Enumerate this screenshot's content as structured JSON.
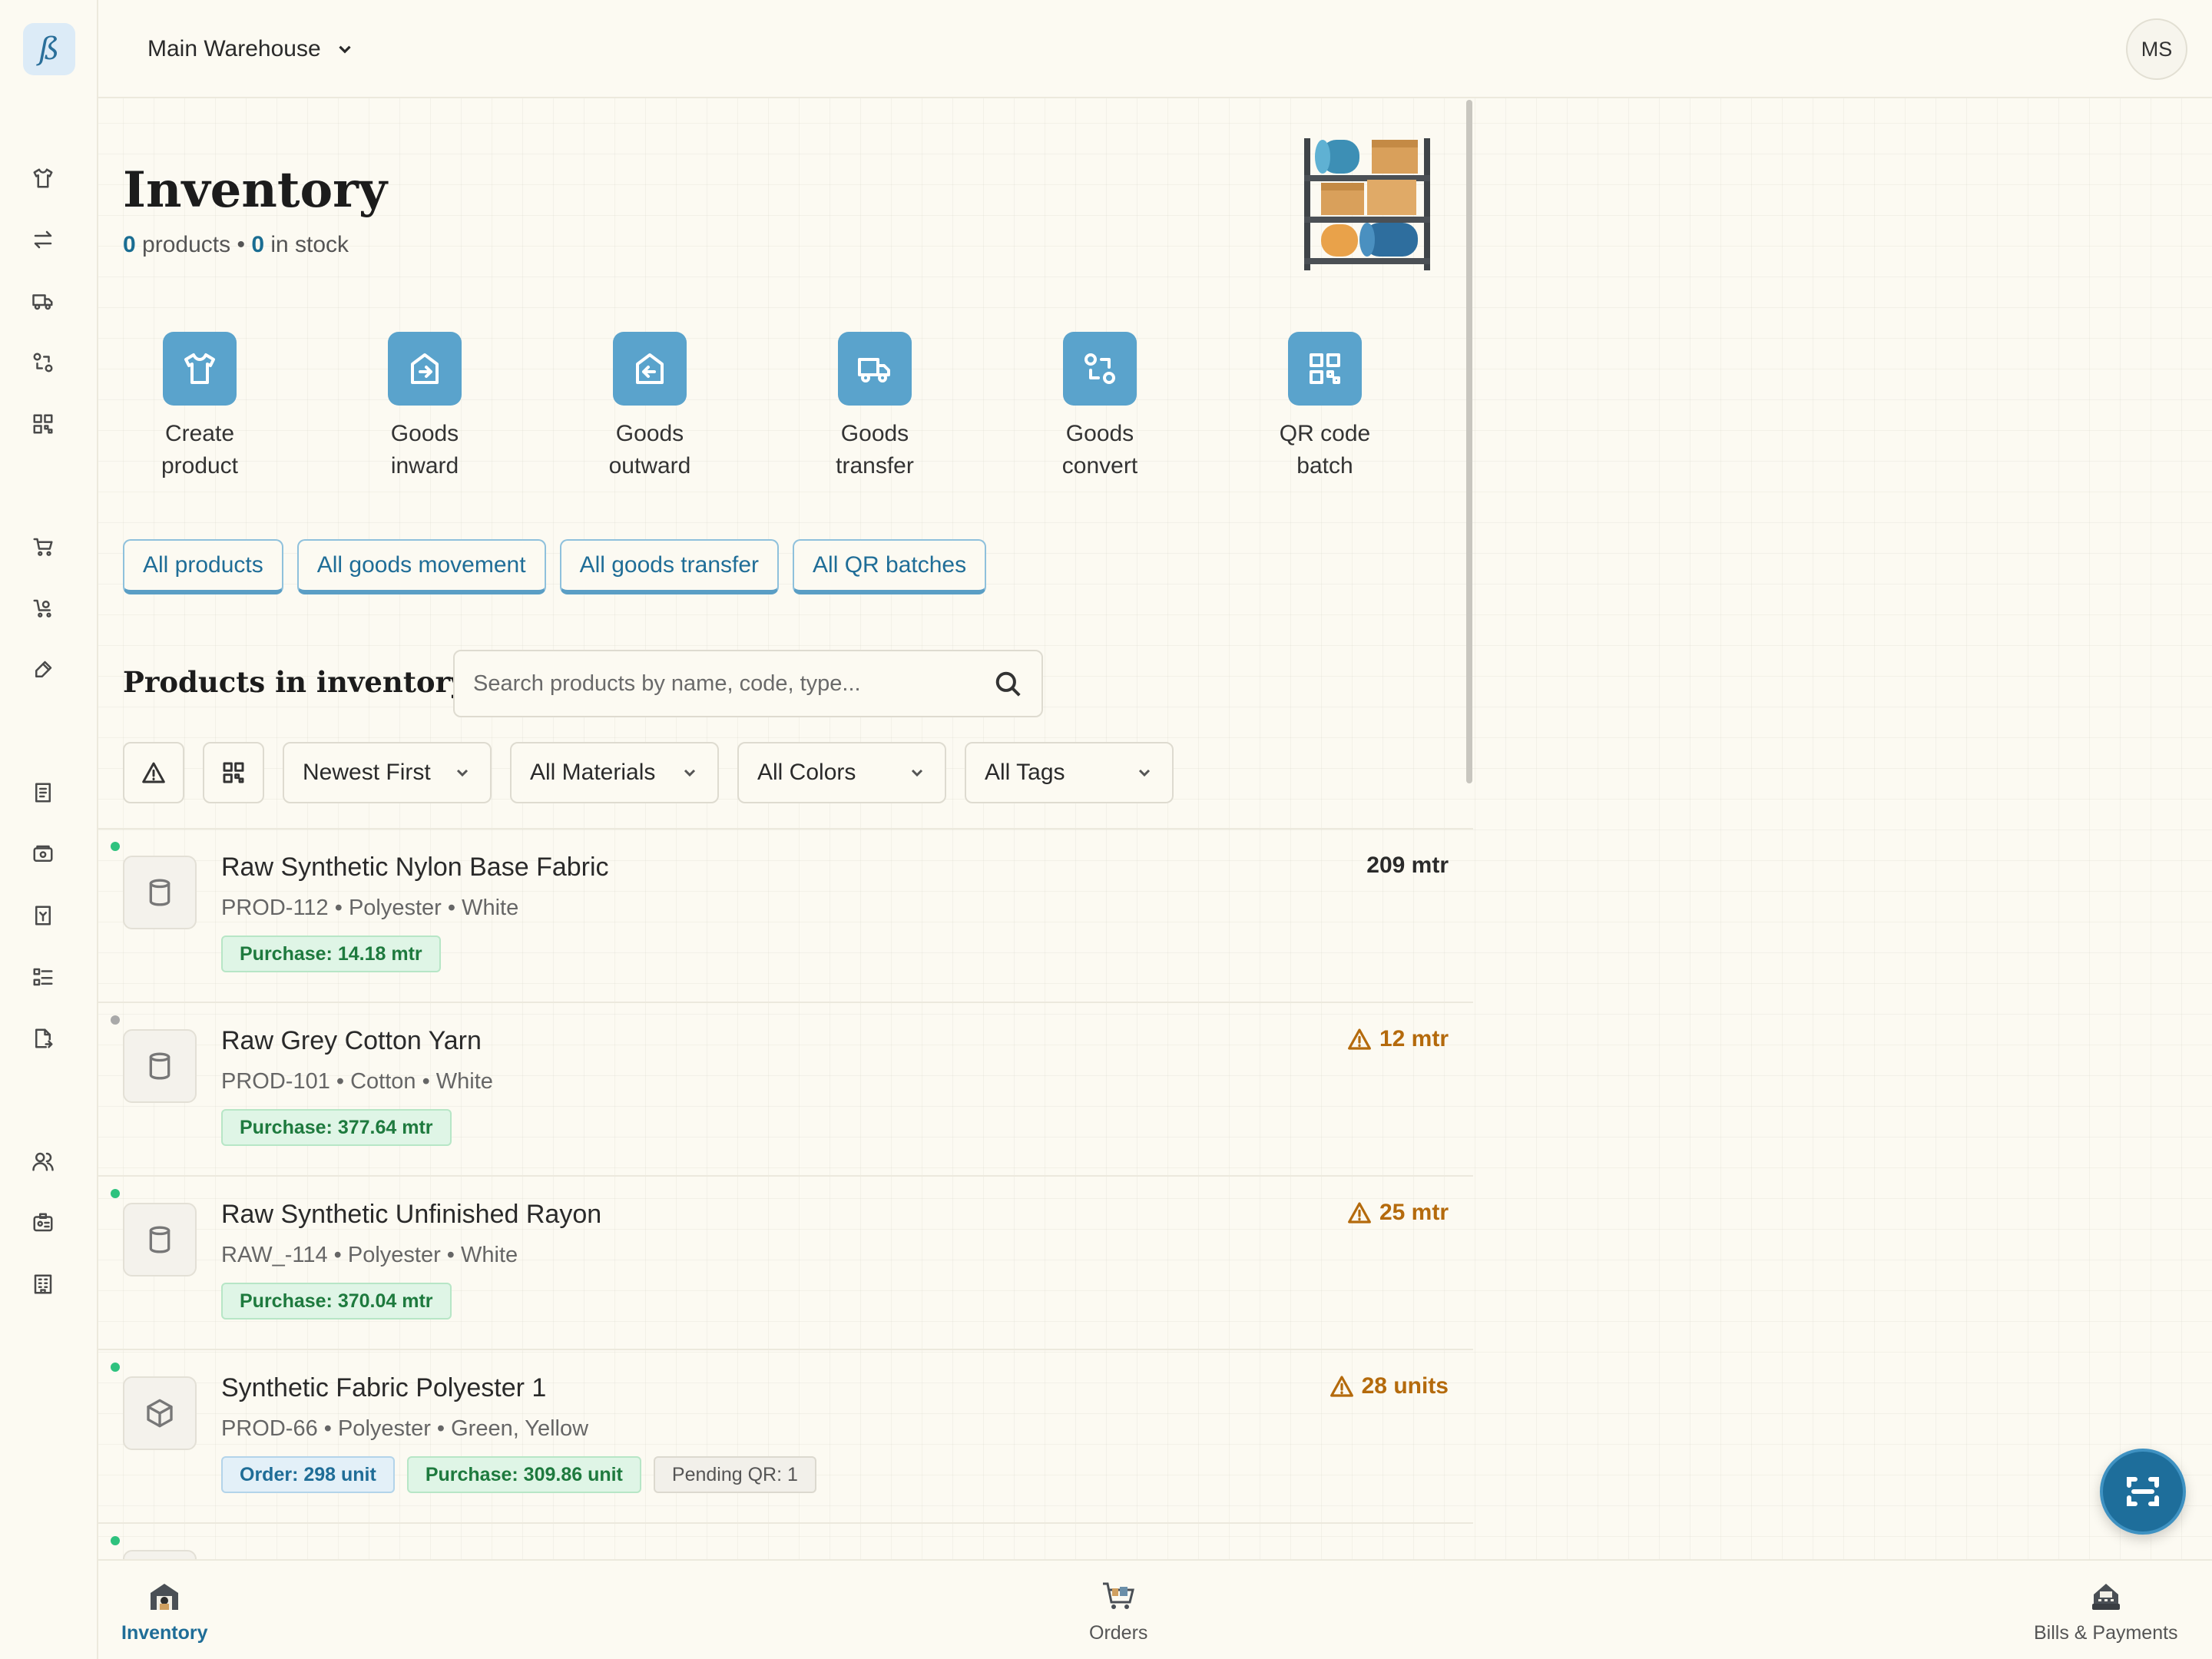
{
  "app": {
    "logo_text": "ß"
  },
  "header": {
    "warehouse": "Main Warehouse",
    "avatar": "MS"
  },
  "page": {
    "title": "Inventory",
    "products_count": "0",
    "products_label": "products",
    "separator": "•",
    "stock_count": "0",
    "stock_label": "in stock"
  },
  "actions": [
    {
      "label": "Create\nproduct",
      "icon": "shirt-icon"
    },
    {
      "label": "Goods\ninward",
      "icon": "inward-icon"
    },
    {
      "label": "Goods\noutward",
      "icon": "outward-icon"
    },
    {
      "label": "Goods\ntransfer",
      "icon": "truck-icon"
    },
    {
      "label": "Goods\nconvert",
      "icon": "convert-icon"
    },
    {
      "label": "QR code\nbatch",
      "icon": "qr-icon"
    }
  ],
  "links": [
    "All products",
    "All goods movement",
    "All goods transfer",
    "All QR batches"
  ],
  "products_section": {
    "title": "Products in inventory",
    "search_placeholder": "Search products by name, code, type..."
  },
  "filters": {
    "sort": "Newest First",
    "materials": "All Materials",
    "colors": "All Colors",
    "tags": "All Tags"
  },
  "products": [
    {
      "name": "Raw Synthetic Nylon Base Fabric",
      "meta": "PROD-112 • Polyester • White",
      "qty": "209 mtr",
      "low": false,
      "status": "green",
      "tags": [
        {
          "text": "Purchase: 14.18 mtr",
          "style": "green"
        }
      ]
    },
    {
      "name": "Raw Grey Cotton Yarn",
      "meta": "PROD-101 • Cotton • White",
      "qty": "12 mtr",
      "low": true,
      "status": "grey",
      "tags": [
        {
          "text": "Purchase: 377.64 mtr",
          "style": "green"
        }
      ]
    },
    {
      "name": "Raw Synthetic Unfinished Rayon",
      "meta": "RAW_-114 • Polyester • White",
      "qty": "25 mtr",
      "low": true,
      "status": "green",
      "tags": [
        {
          "text": "Purchase: 370.04 mtr",
          "style": "green"
        }
      ]
    },
    {
      "name": "Synthetic Fabric Polyester 1",
      "meta": "PROD-66 • Polyester • Green, Yellow",
      "qty": "28 units",
      "low": true,
      "status": "green",
      "tags": [
        {
          "text": "Order: 298 unit",
          "style": "blue"
        },
        {
          "text": "Purchase: 309.86 unit",
          "style": "green"
        },
        {
          "text": "Pending QR: 1",
          "style": "grey"
        }
      ]
    }
  ],
  "bottom_nav": [
    {
      "label": "Inventory",
      "active": true
    },
    {
      "label": "Orders",
      "active": false
    },
    {
      "label": "Bills & Payments",
      "active": false
    }
  ],
  "colors": {
    "accent": "#5aa3cc",
    "primary": "#1f6d97",
    "warning": "#b46a0c",
    "success": "#2ec27e"
  }
}
